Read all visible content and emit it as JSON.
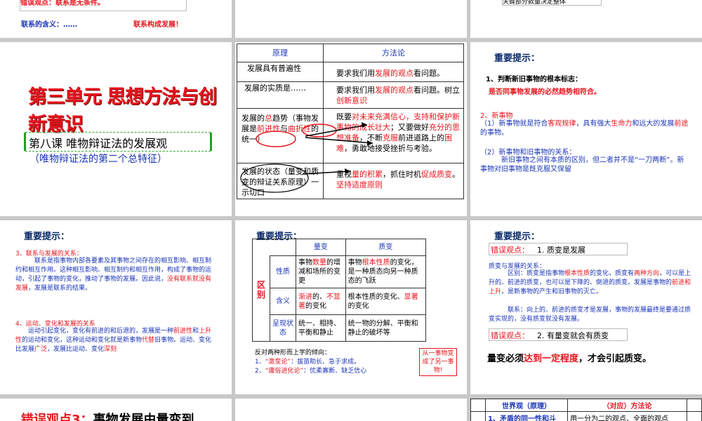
{
  "s1": {
    "error_view": "错误观点：联系是无条件。",
    "meaning": "联系的含义：……",
    "forms": "联系构成发展！"
  },
  "s3": {
    "text": "关键部分数量决定整体"
  },
  "s4": {
    "unit_title": "第三单元 思想方法与创新意识",
    "lesson_title": "第八课 唯物辩证法的发展观",
    "subtitle": "（唯物辩证法的第二个总特征）"
  },
  "s5": {
    "headers": [
      "原理",
      "方法论"
    ],
    "rows": [
      {
        "principle": "发展具有普遍性",
        "method_pre": "要求我们用",
        "method_hl": "发展的观点",
        "method_post": "看问题。"
      },
      {
        "principle": "发展的实质是……",
        "method_pre": "要求我们用",
        "method_hl": "发展的观点",
        "method_post": "看问题。树立",
        "method_hl2": "创新意识"
      },
      {
        "principle_pre": "发展的",
        "principle_hl": "总",
        "principle_mid": "趋势（事物发展是",
        "principle_hl2": "前进性",
        "principle_mid2": "与",
        "principle_hl3": "曲折性",
        "principle_post": "的统一）",
        "method_pre": "既要",
        "method_hl": "对未来充满信心，支持和保护新事物的成长壮大",
        "method_mid": "；又要做好",
        "method_hl2": "充分的思想准备",
        "method_mid2": "，不断",
        "method_hl3": "克服",
        "method_post": "前进道路上的",
        "method_hl4": "困难",
        "method_post2": "，勇敢地接受挫折与考验。"
      },
      {
        "principle": "发展的状态（量变和质变的辩证关系原理）一示切口",
        "method_pre": "重视",
        "method_hl": "量的积累",
        "method_mid": "，抓住时机",
        "method_hl2": "促成质变",
        "method_mid2": "。",
        "method_hl3": "坚持适度原则"
      }
    ]
  },
  "s6": {
    "title": "重要提示：",
    "p1": "1、判断新旧事物的根本标志：",
    "p1b": "是否同事物发展的必然趋势相符合。",
    "p2": "2、新事物",
    "p2a_pre": "（1）新事物就是符合",
    "p2a_h1": "客观规律",
    "p2a_mid": "，具有强大",
    "p2a_h2": "生命力",
    "p2a_mid2": "和远大的发展",
    "p2a_h3": "前途",
    "p2a_post": "的事物。",
    "p2b": "（2）新事物和旧事物的关系：",
    "p2c": "新旧事物之间有本质的区别，但二者并不是“一刀两断”。新事物对旧事物是既克服又保留"
  },
  "s7": {
    "title": "重要提示：",
    "h3": "3、联系与发展的关系：",
    "t3a": "联系是指事物内部各要素及其事物之间存在的相互影响、相互制约和相互作用。这种相互影响、相互制约和相互作用，构成了事物的运动，引起了事物的变化，推动了事物的发展。因此说，",
    "t3b": "没有联系就没有发展",
    "t3c": "，发展是联系的结果。",
    "h4": "4、运动、变化和发展的关系",
    "t4a": "运动引起变化，变化有前进的和后退的，发展是一种",
    "t4b": "前进性",
    "t4c": "和",
    "t4d": "上升性",
    "t4e": "的运动和变化，这种运动和变化就是新事物",
    "t4f": "代替",
    "t4g": "旧事物。运动、变化比发展",
    "t4h": "广泛",
    "t4i": "，发展比运动、变化",
    "t4j": "深刻"
  },
  "s8": {
    "title": "重要提示：",
    "col_headers": [
      "量变",
      "质变"
    ],
    "side_label": "区别",
    "rows": [
      {
        "label": "性质",
        "q_pre": "事物",
        "q_hl": "数量",
        "q_post": "的增减和场所的变更",
        "z_pre": "事物",
        "z_hl": "根本性质",
        "z_post": "的变化，是一种质态向另一种质态的飞跃"
      },
      {
        "label": "含义",
        "q_hl": "渐进",
        "q_mid": "的、",
        "q_hl2": "不显著",
        "q_post": "的变化",
        "z_pre": "根本性质的变化、",
        "z_hl": "显著",
        "z_post": "的变化"
      },
      {
        "label": "呈现状态",
        "q_post": "统一、相持、平衡和静止",
        "z_post": "统一物的分解、平衡和静止的破坏等"
      }
    ],
    "metaphysics": "反对两种形而上学的倾向：",
    "m1_pre": "1、",
    "m1_hl": "“激变论”",
    "m1_post": "：拔苗助长、急于求成。",
    "m2_pre": "2、",
    "m2_hl": "“庸俗进化论”",
    "m2_post": "：优柔寡断、缺乏信心",
    "callout": "从一事物变成了另一事物!"
  },
  "s9": {
    "title": "重要提示：",
    "err1_label": "错误观点：",
    "err1_text": "1. 质变是发展",
    "relation": "质变与发展的关系：",
    "diff_pre": "区别：质变是指事物",
    "diff_h1": "根本性质",
    "diff_mid": "的变化，质变有",
    "diff_h2": "两种方向",
    "diff_mid2": "，可以是上升的、前进的质变，也可以是下降的、倒退的质变。发展是事物的",
    "diff_h3": "前进和上升",
    "diff_post": "，是新事物的产生和旧事物的灭亡。",
    "link": "联系：向上的、前进的质变才是发展，事物的发展最终是要通过质变实现的，没有质变就没有发展。",
    "err2_label": "错误观点：",
    "err2_text": "2. 有量变就会有质变",
    "conclusion_pre": "量变必须",
    "conclusion_hl": "达到一定程度",
    "conclusion_post": "，才会引起质变。"
  },
  "s10": {
    "text_pre": "错误观点3：",
    "text_post": "事物发展由量变到"
  },
  "s12": {
    "headers": [
      "世界观（原理）",
      "（对应）方法论"
    ],
    "row_principle": "1、矛盾的同一性和斗",
    "row_method": "用一分为二的观点、全面的观点"
  }
}
